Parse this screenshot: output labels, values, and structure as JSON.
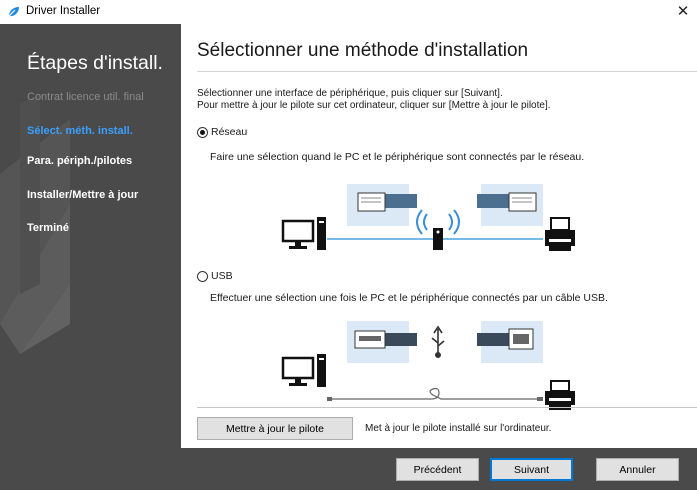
{
  "window": {
    "title": "Driver Installer",
    "close": "✕"
  },
  "sidebar": {
    "title": "Étapes d'install.",
    "items": [
      {
        "label": "Contrat licence util. final",
        "state": "disabled"
      },
      {
        "label": "Sélect. méth. install.",
        "state": "active"
      },
      {
        "label": "Para. périph./pilotes",
        "state": "normal"
      },
      {
        "label": "Installer/Mettre à jour",
        "state": "normal"
      },
      {
        "label": "Terminé",
        "state": "normal"
      }
    ]
  },
  "main": {
    "title": "Sélectionner une méthode d'installation",
    "intro_line1": "Sélectionner une interface de périphérique, puis cliquer sur [Suivant].",
    "intro_line2": "Pour mettre à jour le pilote sur cet ordinateur, cliquer sur [Mettre à jour le pilote].",
    "options": [
      {
        "label": "Réseau",
        "checked": true,
        "description": "Faire une sélection quand le PC et le périphérique sont connectés par le réseau."
      },
      {
        "label": "USB",
        "checked": false,
        "description": "Effectuer une sélection une fois le PC et le périphérique connectés par un câble USB."
      }
    ],
    "update_button": "Mettre à jour le pilote",
    "update_description": "Met à jour le pilote installé sur l'ordinateur."
  },
  "footer": {
    "prev": "Précédent",
    "next": "Suivant",
    "cancel": "Annuler"
  },
  "colors": {
    "accent": "#0078d7",
    "active_step": "#3aa0ff",
    "panel": "#4a4a4a",
    "illustration_bg": "#dbe9f6",
    "connector": "#4d6f8f"
  }
}
